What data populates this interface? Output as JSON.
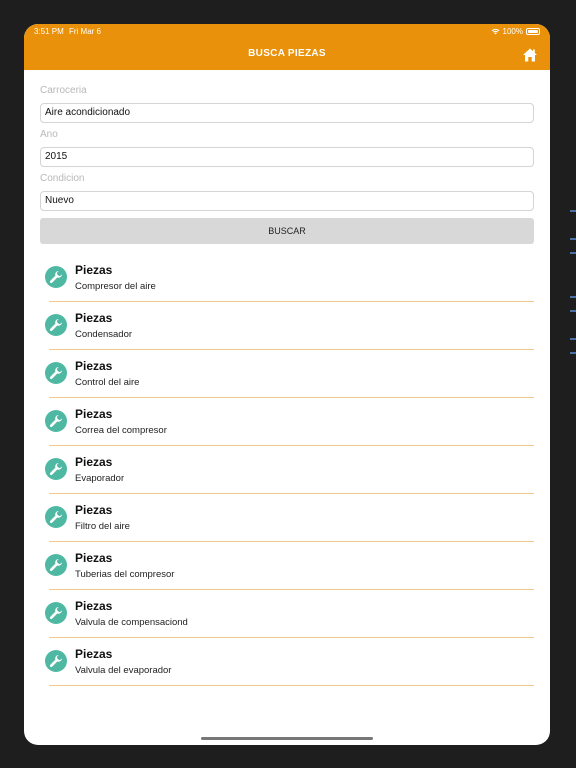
{
  "status_bar": {
    "time": "3:51 PM",
    "date": "Fri Mar 6",
    "battery": "100%"
  },
  "nav": {
    "title": "BUSCA PIEZAS",
    "home_icon": "home-icon"
  },
  "form": {
    "fields": [
      {
        "label": "Carroceria",
        "value": "Aire acondicionado"
      },
      {
        "label": "Ano",
        "value": "2015"
      },
      {
        "label": "Condicion",
        "value": "Nuevo"
      }
    ],
    "search_label": "BUSCAR"
  },
  "results": [
    {
      "title": "Piezas",
      "subtitle": "Compresor del aire"
    },
    {
      "title": "Piezas",
      "subtitle": "Condensador"
    },
    {
      "title": "Piezas",
      "subtitle": "Control del aire"
    },
    {
      "title": "Piezas",
      "subtitle": "Correa del compresor"
    },
    {
      "title": "Piezas",
      "subtitle": "Evaporador"
    },
    {
      "title": "Piezas",
      "subtitle": "Filtro del aire"
    },
    {
      "title": "Piezas",
      "subtitle": "Tuberias del compresor"
    },
    {
      "title": "Piezas",
      "subtitle": "Valvula de compensaciond"
    },
    {
      "title": "Piezas",
      "subtitle": "Valvula del evaporador"
    }
  ],
  "colors": {
    "accent": "#e9910a",
    "icon_bg": "#4fb8a3",
    "divider": "#f2c98a"
  }
}
